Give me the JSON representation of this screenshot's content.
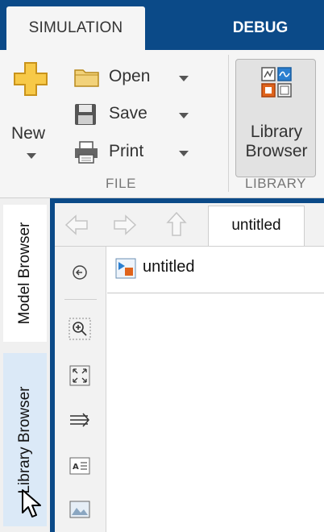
{
  "tabs": {
    "simulation": "SIMULATION",
    "debug": "DEBUG"
  },
  "ribbon": {
    "new_label": "New",
    "open_label": "Open",
    "save_label": "Save",
    "print_label": "Print",
    "file_section": "FILE",
    "library_line1": "Library",
    "library_line2": "Browser",
    "library_section": "LIBRARY"
  },
  "side_tabs": {
    "model_browser": "Model Browser",
    "library_browser": "Library Browser"
  },
  "editor": {
    "model_tab": "untitled",
    "breadcrumb": "untitled"
  },
  "colors": {
    "toolstrip_blue": "#0b4a88",
    "ribbon_bg": "#f5f5f5",
    "new_icon_yellow": "#f7c948",
    "selected_side_tab": "#dbe9f7"
  },
  "icons": {
    "new": "plus-icon",
    "open": "folder-icon",
    "save": "floppy-disk-icon",
    "print": "printer-icon",
    "library": "library-browser-icon",
    "back": "back-arrow-icon",
    "forward": "forward-arrow-icon",
    "up": "up-arrow-icon",
    "hide_browser": "hide-browser-icon",
    "zoom": "zoom-icon",
    "fit": "fit-to-view-icon",
    "signal": "signal-arrow-icon",
    "annotation": "text-annotation-icon",
    "image": "image-icon",
    "model": "model-icon"
  }
}
